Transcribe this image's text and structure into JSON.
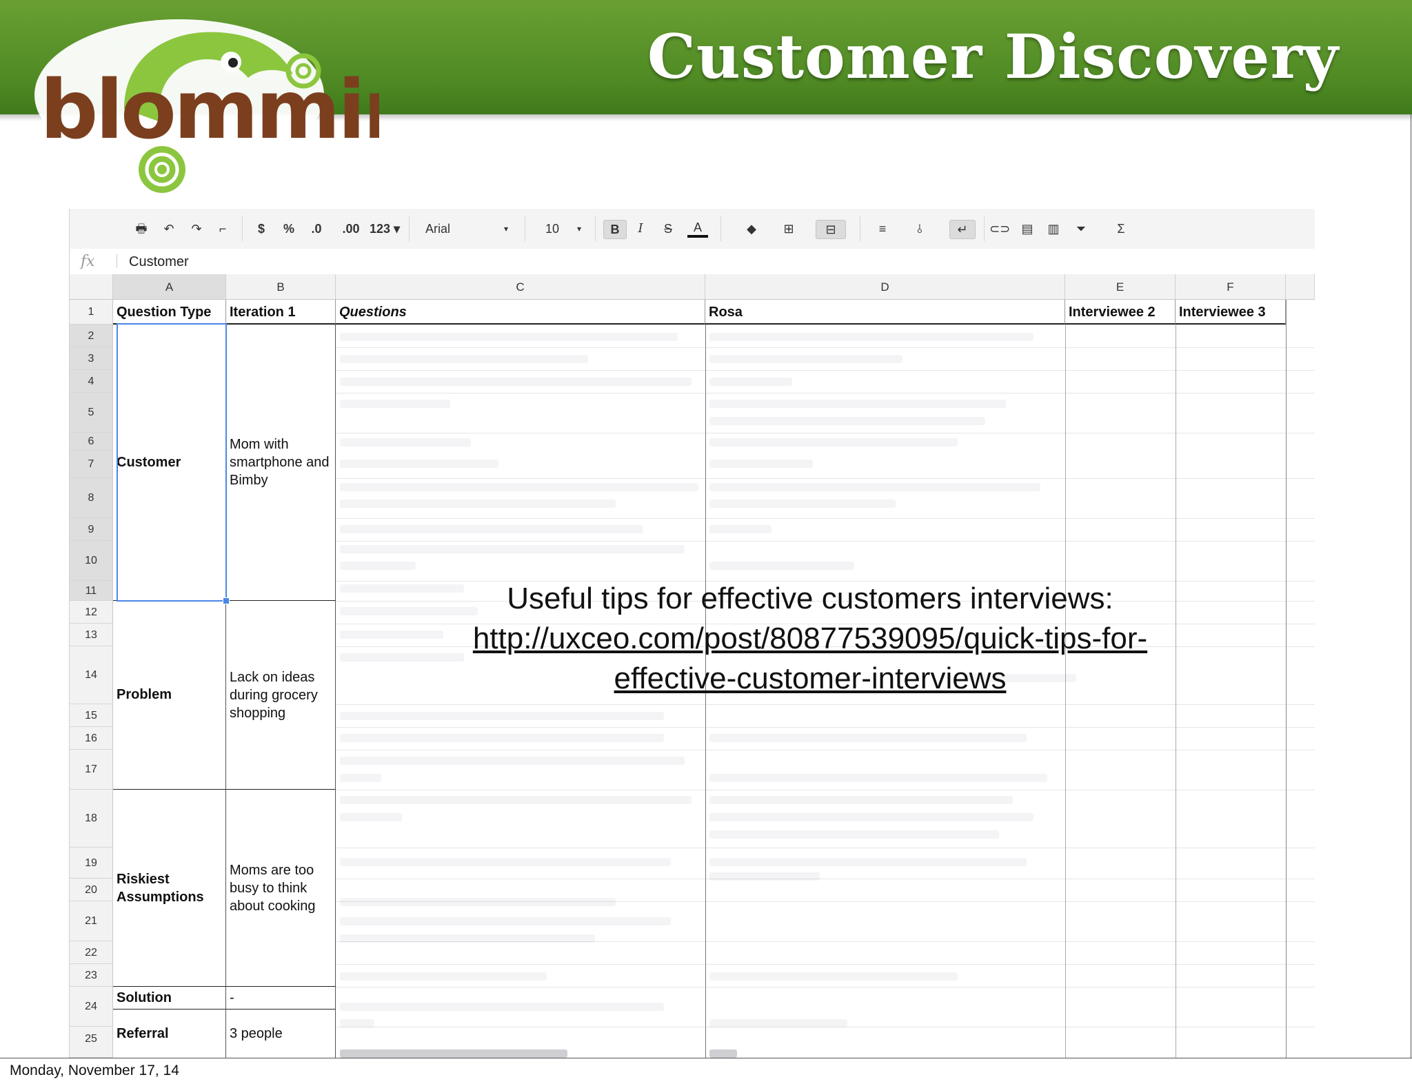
{
  "slide": {
    "title": "Customer Discovery",
    "logo_text": "blomming",
    "footer_date": "Monday, November 17, 14"
  },
  "colors": {
    "banner": "#5a9429",
    "logo_brown": "#7b3f1e",
    "logo_green": "#8cc63f",
    "selection": "#4a86e8"
  },
  "toolbar": {
    "items": [
      {
        "icon": "print-icon",
        "glyph": "🖶"
      },
      {
        "icon": "undo-icon",
        "glyph": "↶"
      },
      {
        "icon": "redo-icon",
        "glyph": "↷"
      },
      {
        "icon": "paint-format-icon",
        "glyph": "⌐"
      },
      {
        "icon": "currency-format-icon",
        "label": "$"
      },
      {
        "icon": "percent-format-icon",
        "label": "%"
      },
      {
        "icon": "decrease-decimal-icon",
        "label": ".0"
      },
      {
        "icon": "increase-decimal-icon",
        "label": ".00"
      },
      {
        "icon": "more-formats-icon",
        "label": "123 ▾"
      }
    ],
    "font": "Arial",
    "font_size": "10",
    "format_buttons": [
      {
        "icon": "bold-icon",
        "label": "B"
      },
      {
        "icon": "italic-icon",
        "label": "I"
      },
      {
        "icon": "strikethrough-icon",
        "label": "S"
      },
      {
        "icon": "text-color-icon",
        "label": "A"
      }
    ],
    "extra_icons": [
      "fill-color-icon",
      "borders-icon",
      "merge-cells-icon",
      "align-icon",
      "valign-icon",
      "wrap-text-icon",
      "link-icon",
      "comment-icon",
      "chart-icon",
      "filter-icon",
      "functions-icon"
    ]
  },
  "formula_bar": {
    "icon": "fx",
    "value": "Customer"
  },
  "columns": [
    "A",
    "B",
    "C",
    "D",
    "E",
    "F"
  ],
  "rows": [
    "1",
    "2",
    "3",
    "4",
    "5",
    "6",
    "7",
    "8",
    "9",
    "10",
    "11",
    "12",
    "13",
    "14",
    "15",
    "16",
    "17",
    "18",
    "19",
    "20",
    "21",
    "22",
    "23",
    "24",
    "25"
  ],
  "header_row": {
    "a": "Question Type",
    "b": "Iteration 1",
    "c": "Questions",
    "d": "Rosa",
    "e": "Interviewee 2",
    "f": "Interviewee 3"
  },
  "groups": [
    {
      "type": "Customer",
      "iteration": "Mom with smartphone and Bimby"
    },
    {
      "type": "Problem",
      "iteration": "Lack on ideas during grocery shopping"
    },
    {
      "type": "Riskiest Assumptions",
      "iteration": "Moms are too busy to think about cooking"
    },
    {
      "type": "Solution",
      "iteration": "-"
    },
    {
      "type": "Referral",
      "iteration": "3 people"
    }
  ],
  "tips": {
    "line1": "Useful tips for effective customers interviews:",
    "link": "http://uxceo.com/post/80877539095/quick-tips-for-effective-customer-interviews"
  }
}
